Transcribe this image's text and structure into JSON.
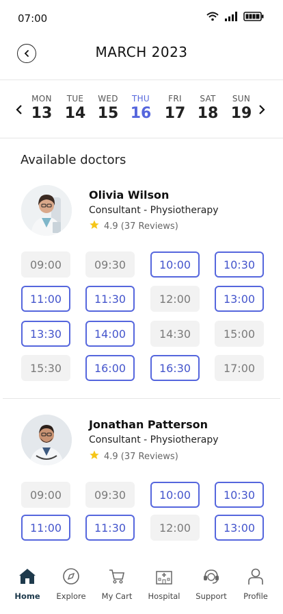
{
  "status": {
    "time": "07:00"
  },
  "header": {
    "title": "MARCH 2023"
  },
  "dates": [
    {
      "day": "MON",
      "date": "13"
    },
    {
      "day": "TUE",
      "date": "14"
    },
    {
      "day": "WED",
      "date": "15"
    },
    {
      "day": "THU",
      "date": "16",
      "selected": true
    },
    {
      "day": "FRI",
      "date": "17"
    },
    {
      "day": "SAT",
      "date": "18"
    },
    {
      "day": "SUN",
      "date": "19"
    }
  ],
  "section_title": "Available doctors",
  "doctors": [
    {
      "name": "Olivia Wilson",
      "specialty": "Consultant - Physiotherapy",
      "rating": "4.9 (37 Reviews)",
      "slots": [
        {
          "time": "09:00",
          "available": false
        },
        {
          "time": "09:30",
          "available": false
        },
        {
          "time": "10:00",
          "available": true
        },
        {
          "time": "10:30",
          "available": true
        },
        {
          "time": "11:00",
          "available": true
        },
        {
          "time": "11:30",
          "available": true
        },
        {
          "time": "12:00",
          "available": false
        },
        {
          "time": "13:00",
          "available": true
        },
        {
          "time": "13:30",
          "available": true
        },
        {
          "time": "14:00",
          "available": true
        },
        {
          "time": "14:30",
          "available": false
        },
        {
          "time": "15:00",
          "available": false
        },
        {
          "time": "15:30",
          "available": false
        },
        {
          "time": "16:00",
          "available": true
        },
        {
          "time": "16:30",
          "available": true
        },
        {
          "time": "17:00",
          "available": false
        }
      ]
    },
    {
      "name": "Jonathan Patterson",
      "specialty": "Consultant - Physiotherapy",
      "rating": "4.9 (37 Reviews)",
      "slots": [
        {
          "time": "09:00",
          "available": false
        },
        {
          "time": "09:30",
          "available": false
        },
        {
          "time": "10:00",
          "available": true
        },
        {
          "time": "10:30",
          "available": true
        },
        {
          "time": "11:00",
          "available": true
        },
        {
          "time": "11:30",
          "available": true
        },
        {
          "time": "12:00",
          "available": false
        },
        {
          "time": "13:00",
          "available": true
        }
      ]
    }
  ],
  "nav": [
    {
      "label": "Home",
      "icon": "home-icon",
      "active": true
    },
    {
      "label": "Explore",
      "icon": "compass-icon"
    },
    {
      "label": "My Cart",
      "icon": "cart-icon"
    },
    {
      "label": "Hospital",
      "icon": "hospital-icon"
    },
    {
      "label": "Support",
      "icon": "support-icon"
    },
    {
      "label": "Profile",
      "icon": "user-icon"
    }
  ],
  "colors": {
    "accent": "#5566dd",
    "slot_disabled_bg": "#f2f2f2",
    "nav_active": "#1e3a4c"
  }
}
